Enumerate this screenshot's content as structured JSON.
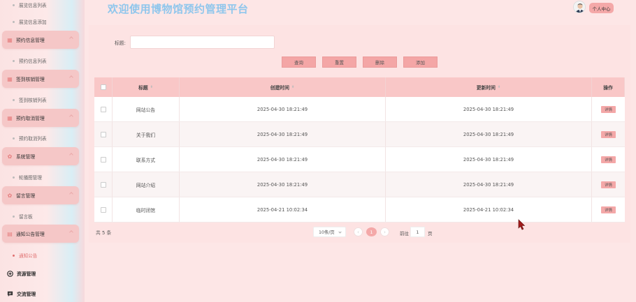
{
  "sidebar": {
    "top_items": [
      "展览信息列表",
      "展览信息添加"
    ],
    "groups": [
      {
        "label": "预约信息管理",
        "icon": "grid-icon",
        "sub": "预约信息列表"
      },
      {
        "label": "签到核销管理",
        "icon": "grid-icon",
        "sub": "签到核销列表"
      },
      {
        "label": "预约取消管理",
        "icon": "grid-icon",
        "sub": "预约取消列表"
      },
      {
        "label": "系统管理",
        "icon": "gear-icon",
        "sub": "轮播图管理"
      },
      {
        "label": "留言管理",
        "icon": "gear-icon",
        "sub": "留言板"
      },
      {
        "label": "通知公告管理",
        "icon": "doc-icon",
        "sub": "通知公告"
      }
    ],
    "plain_items": [
      {
        "label": "资源管理",
        "icon": "plus-circle-icon"
      },
      {
        "label": "交流管理",
        "icon": "chat-icon"
      }
    ]
  },
  "header": {
    "title": "欢迎使用博物馆预约管理平台",
    "user_center": "个人中心"
  },
  "search": {
    "label": "标题:",
    "value": ""
  },
  "buttons": {
    "query": "查询",
    "reset": "重置",
    "delete": "删除",
    "add": "添加"
  },
  "table": {
    "columns": [
      "标题",
      "创建时间",
      "更新时间",
      "操作"
    ],
    "rows": [
      {
        "title": "网站公告",
        "created": "2025-04-30 18:21:49",
        "updated": "2025-04-30 18:21:49",
        "action": "详情"
      },
      {
        "title": "关于我们",
        "created": "2025-04-30 18:21:49",
        "updated": "2025-04-30 18:21:49",
        "action": "详情"
      },
      {
        "title": "联系方式",
        "created": "2025-04-30 18:21:49",
        "updated": "2025-04-30 18:21:49",
        "action": "详情"
      },
      {
        "title": "网站介绍",
        "created": "2025-04-30 18:21:49",
        "updated": "2025-04-30 18:21:49",
        "action": "详情"
      },
      {
        "title": "临时闭馆",
        "created": "2025-04-21 10:02:34",
        "updated": "2025-04-21 10:02:34",
        "action": "详情"
      }
    ]
  },
  "pagination": {
    "total": "共 5 条",
    "page_size": "10条/页",
    "prev": "‹",
    "current": "1",
    "next": "›",
    "goto_label": "前往",
    "goto_value": "1",
    "page_suffix": "页"
  },
  "colors": {
    "accent": "#f4a8a8",
    "title": "#8fc6ec",
    "background": "#fde6e6"
  }
}
